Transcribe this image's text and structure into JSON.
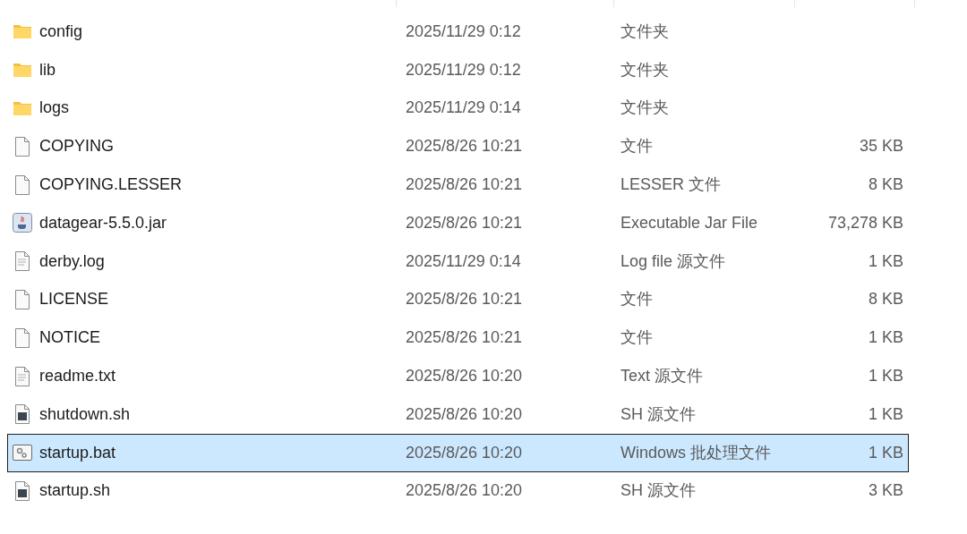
{
  "files": [
    {
      "kind": "folder",
      "name": "config",
      "modified": "2025/11/29 0:12",
      "type": "文件夹",
      "selected": false
    },
    {
      "kind": "folder",
      "name": "lib",
      "modified": "2025/11/29 0:12",
      "type": "文件夹",
      "selected": false
    },
    {
      "kind": "folder",
      "name": "logs",
      "modified": "2025/11/29 0:14",
      "type": "文件夹",
      "selected": false
    },
    {
      "kind": "blank",
      "name": "COPYING",
      "modified": "2025/8/26 10:21",
      "type": "文件",
      "size": "35 KB",
      "selected": false
    },
    {
      "kind": "blank",
      "name": "COPYING.LESSER",
      "modified": "2025/8/26 10:21",
      "type": "LESSER 文件",
      "size": "8 KB",
      "selected": false
    },
    {
      "kind": "jar",
      "name": "datagear-5.5.0.jar",
      "modified": "2025/8/26 10:21",
      "type": "Executable Jar File",
      "size": "73,278 KB",
      "selected": false
    },
    {
      "kind": "text",
      "name": "derby.log",
      "modified": "2025/11/29 0:14",
      "type": "Log file 源文件",
      "size": "1 KB",
      "selected": false
    },
    {
      "kind": "blank",
      "name": "LICENSE",
      "modified": "2025/8/26 10:21",
      "type": "文件",
      "size": "8 KB",
      "selected": false
    },
    {
      "kind": "blank",
      "name": "NOTICE",
      "modified": "2025/8/26 10:21",
      "type": "文件",
      "size": "1 KB",
      "selected": false
    },
    {
      "kind": "text",
      "name": "readme.txt",
      "modified": "2025/8/26 10:20",
      "type": "Text 源文件",
      "size": "1 KB",
      "selected": false
    },
    {
      "kind": "script",
      "name": "shutdown.sh",
      "modified": "2025/8/26 10:20",
      "type": "SH 源文件",
      "size": "1 KB",
      "selected": false
    },
    {
      "kind": "batch",
      "name": "startup.bat",
      "modified": "2025/8/26 10:20",
      "type": "Windows 批处理文件",
      "size": "1 KB",
      "selected": true
    },
    {
      "kind": "script",
      "name": "startup.sh",
      "modified": "2025/8/26 10:20",
      "type": "SH 源文件",
      "size": "3 KB",
      "selected": false
    }
  ]
}
